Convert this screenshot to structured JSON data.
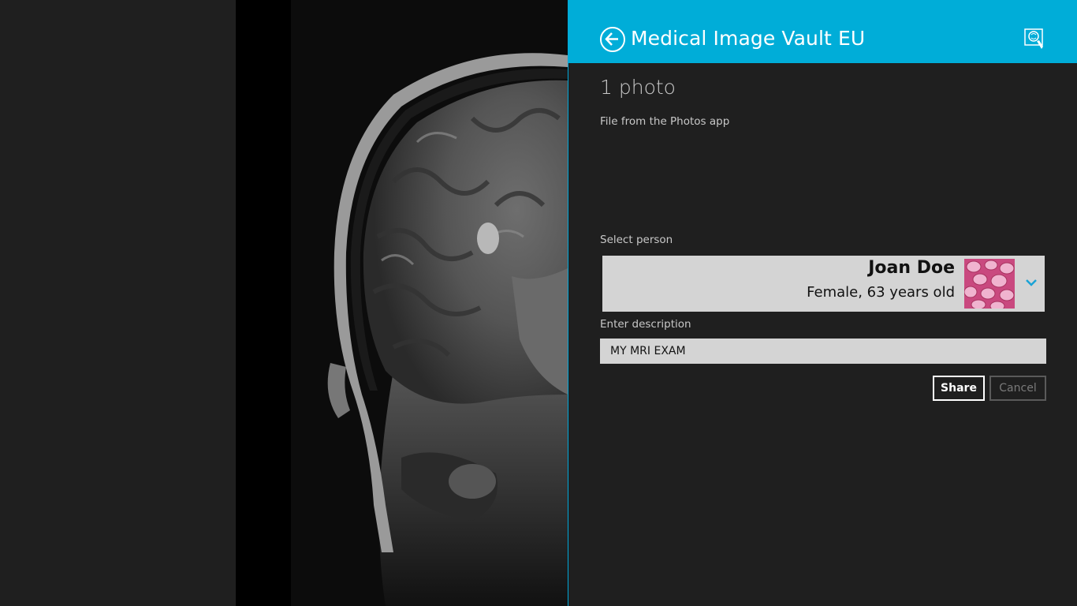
{
  "header": {
    "title": "Medical Image Vault EU",
    "back_icon": "back-arrow-icon",
    "logo_icon": "brain-touch-icon"
  },
  "share": {
    "photo_count": "1 photo",
    "source": "File from the Photos app"
  },
  "person": {
    "label": "Select person",
    "name": "Joan Doe",
    "info": "Female, 63 years old",
    "thumbnail_icon": "person-avatar-thumbnail",
    "chevron_icon": "chevron-down-icon"
  },
  "description": {
    "label": "Enter description",
    "value": "MY MRI EXAM"
  },
  "buttons": {
    "share": "Share",
    "cancel": "Cancel"
  },
  "colors": {
    "header_bg": "#00add8",
    "accent": "#00a8d9",
    "pane_bg": "#1f1f1f",
    "field_bg": "#d4d4d4"
  }
}
